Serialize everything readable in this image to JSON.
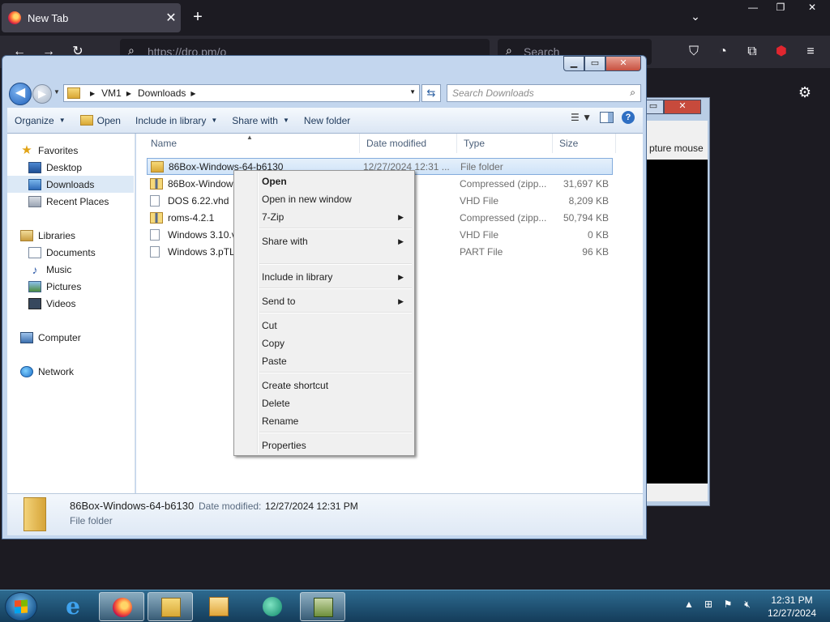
{
  "browser": {
    "tab_title": "New Tab",
    "tab_close": "✕",
    "new_tab": "+",
    "list_tabs": "⌄",
    "url_placeholder": "https://dro.pm/o",
    "search_placeholder": "Search",
    "window_controls": [
      "—",
      "❐",
      "✕"
    ]
  },
  "vm_window": {
    "status_text": "pture mouse"
  },
  "explorer": {
    "breadcrumb": [
      "VM1",
      "Downloads"
    ],
    "search_placeholder": "Search Downloads",
    "toolbar": {
      "organize": "Organize",
      "open": "Open",
      "include_in_library": "Include in library",
      "share_with": "Share with",
      "new_folder": "New folder"
    },
    "nav": {
      "favorites": "Favorites",
      "desktop": "Desktop",
      "downloads": "Downloads",
      "recent_places": "Recent Places",
      "libraries": "Libraries",
      "documents": "Documents",
      "music": "Music",
      "pictures": "Pictures",
      "videos": "Videos",
      "computer": "Computer",
      "network": "Network"
    },
    "columns": [
      "Name",
      "Date modified",
      "Type",
      "Size"
    ],
    "files": [
      {
        "name": "86Box-Windows-64-b6130",
        "date": "12/27/2024 12:31 ...",
        "type": "File folder",
        "size": "",
        "icon": "folder-icon"
      },
      {
        "name": "86Box-Windows",
        "date": "2:18 ...",
        "type": "Compressed (zipp...",
        "size": "31,697 KB",
        "icon": "zip-icon"
      },
      {
        "name": "DOS 6.22.vhd",
        "date": "2:28 ...",
        "type": "VHD File",
        "size": "8,209 KB",
        "icon": "file-icon"
      },
      {
        "name": "roms-4.2.1",
        "date": "2:20 ...",
        "type": "Compressed (zipp...",
        "size": "50,794 KB",
        "icon": "zip-icon"
      },
      {
        "name": "Windows 3.10.v",
        "date": "2:30 ...",
        "type": "VHD File",
        "size": "0 KB",
        "icon": "file-icon"
      },
      {
        "name": "Windows 3.pTL",
        "date": "2:30 ...",
        "type": "PART File",
        "size": "96 KB",
        "icon": "file-icon"
      }
    ],
    "details": {
      "name": "86Box-Windows-64-b6130",
      "date_label": "Date modified:",
      "date_value": "12/27/2024 12:31 PM",
      "type": "File folder"
    }
  },
  "context_menu": {
    "open": "Open",
    "open_new_window": "Open in new window",
    "seven_zip": "7-Zip",
    "share_with": "Share with",
    "include_in_library": "Include in library",
    "send_to": "Send to",
    "cut": "Cut",
    "copy": "Copy",
    "paste": "Paste",
    "create_shortcut": "Create shortcut",
    "delete": "Delete",
    "rename": "Rename",
    "properties": "Properties"
  },
  "taskbar": {
    "time": "12:31 PM",
    "date": "12/27/2024"
  }
}
